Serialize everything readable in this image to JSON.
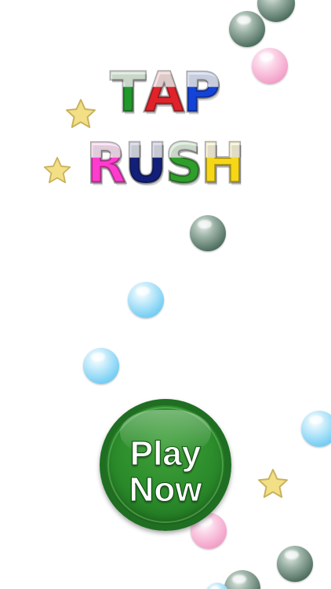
{
  "title": {
    "line1": [
      "T",
      "A",
      "P"
    ],
    "line2": [
      "R",
      "U",
      "S",
      "H"
    ],
    "line1_colors": [
      "#1f9a2a",
      "#e0232a",
      "#1443d8"
    ],
    "line2_colors": [
      "#ff3ccd",
      "#d64be0",
      "#13207a",
      "#2f9e2c",
      "#f6d717"
    ]
  },
  "play_button": {
    "line1": "Play",
    "line2": "Now",
    "color": "#2a8a2a"
  },
  "colors": {
    "background": "#ffffff",
    "grey_bubble": "#5e7d6f",
    "blue_bubble": "#8dd6f5",
    "pink_bubble": "#f3a2c9",
    "star": "#f2df86"
  },
  "decorations": {
    "bubble_icons": [
      "grey-bubble",
      "blue-bubble",
      "pink-bubble"
    ],
    "star_icon": "star-icon"
  }
}
